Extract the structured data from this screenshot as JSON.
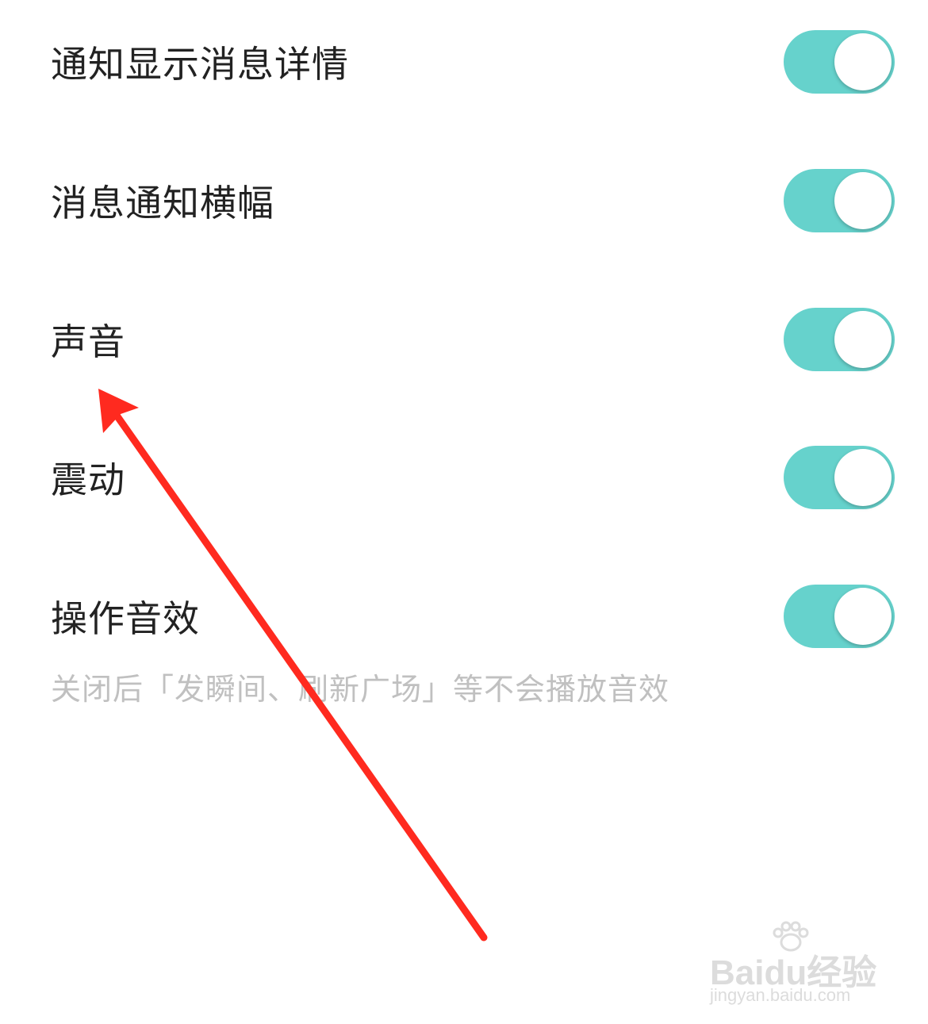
{
  "settings": [
    {
      "label": "通知显示消息详情",
      "enabled": true
    },
    {
      "label": "消息通知横幅",
      "enabled": true
    },
    {
      "label": "声音",
      "enabled": true
    },
    {
      "label": "震动",
      "enabled": true
    },
    {
      "label": "操作音效",
      "enabled": true
    }
  ],
  "hint": "关闭后「发瞬间、刷新广场」等不会播放音效",
  "colors": {
    "toggle_on": "#66d2cc",
    "label": "#222222",
    "hint": "#c0c0c0",
    "annotation_arrow": "#ff2a1f"
  },
  "annotation": {
    "icon": "red-arrow-annotation"
  },
  "watermark": {
    "logo": "Baidu经验",
    "url": "jingyan.baidu.com"
  }
}
